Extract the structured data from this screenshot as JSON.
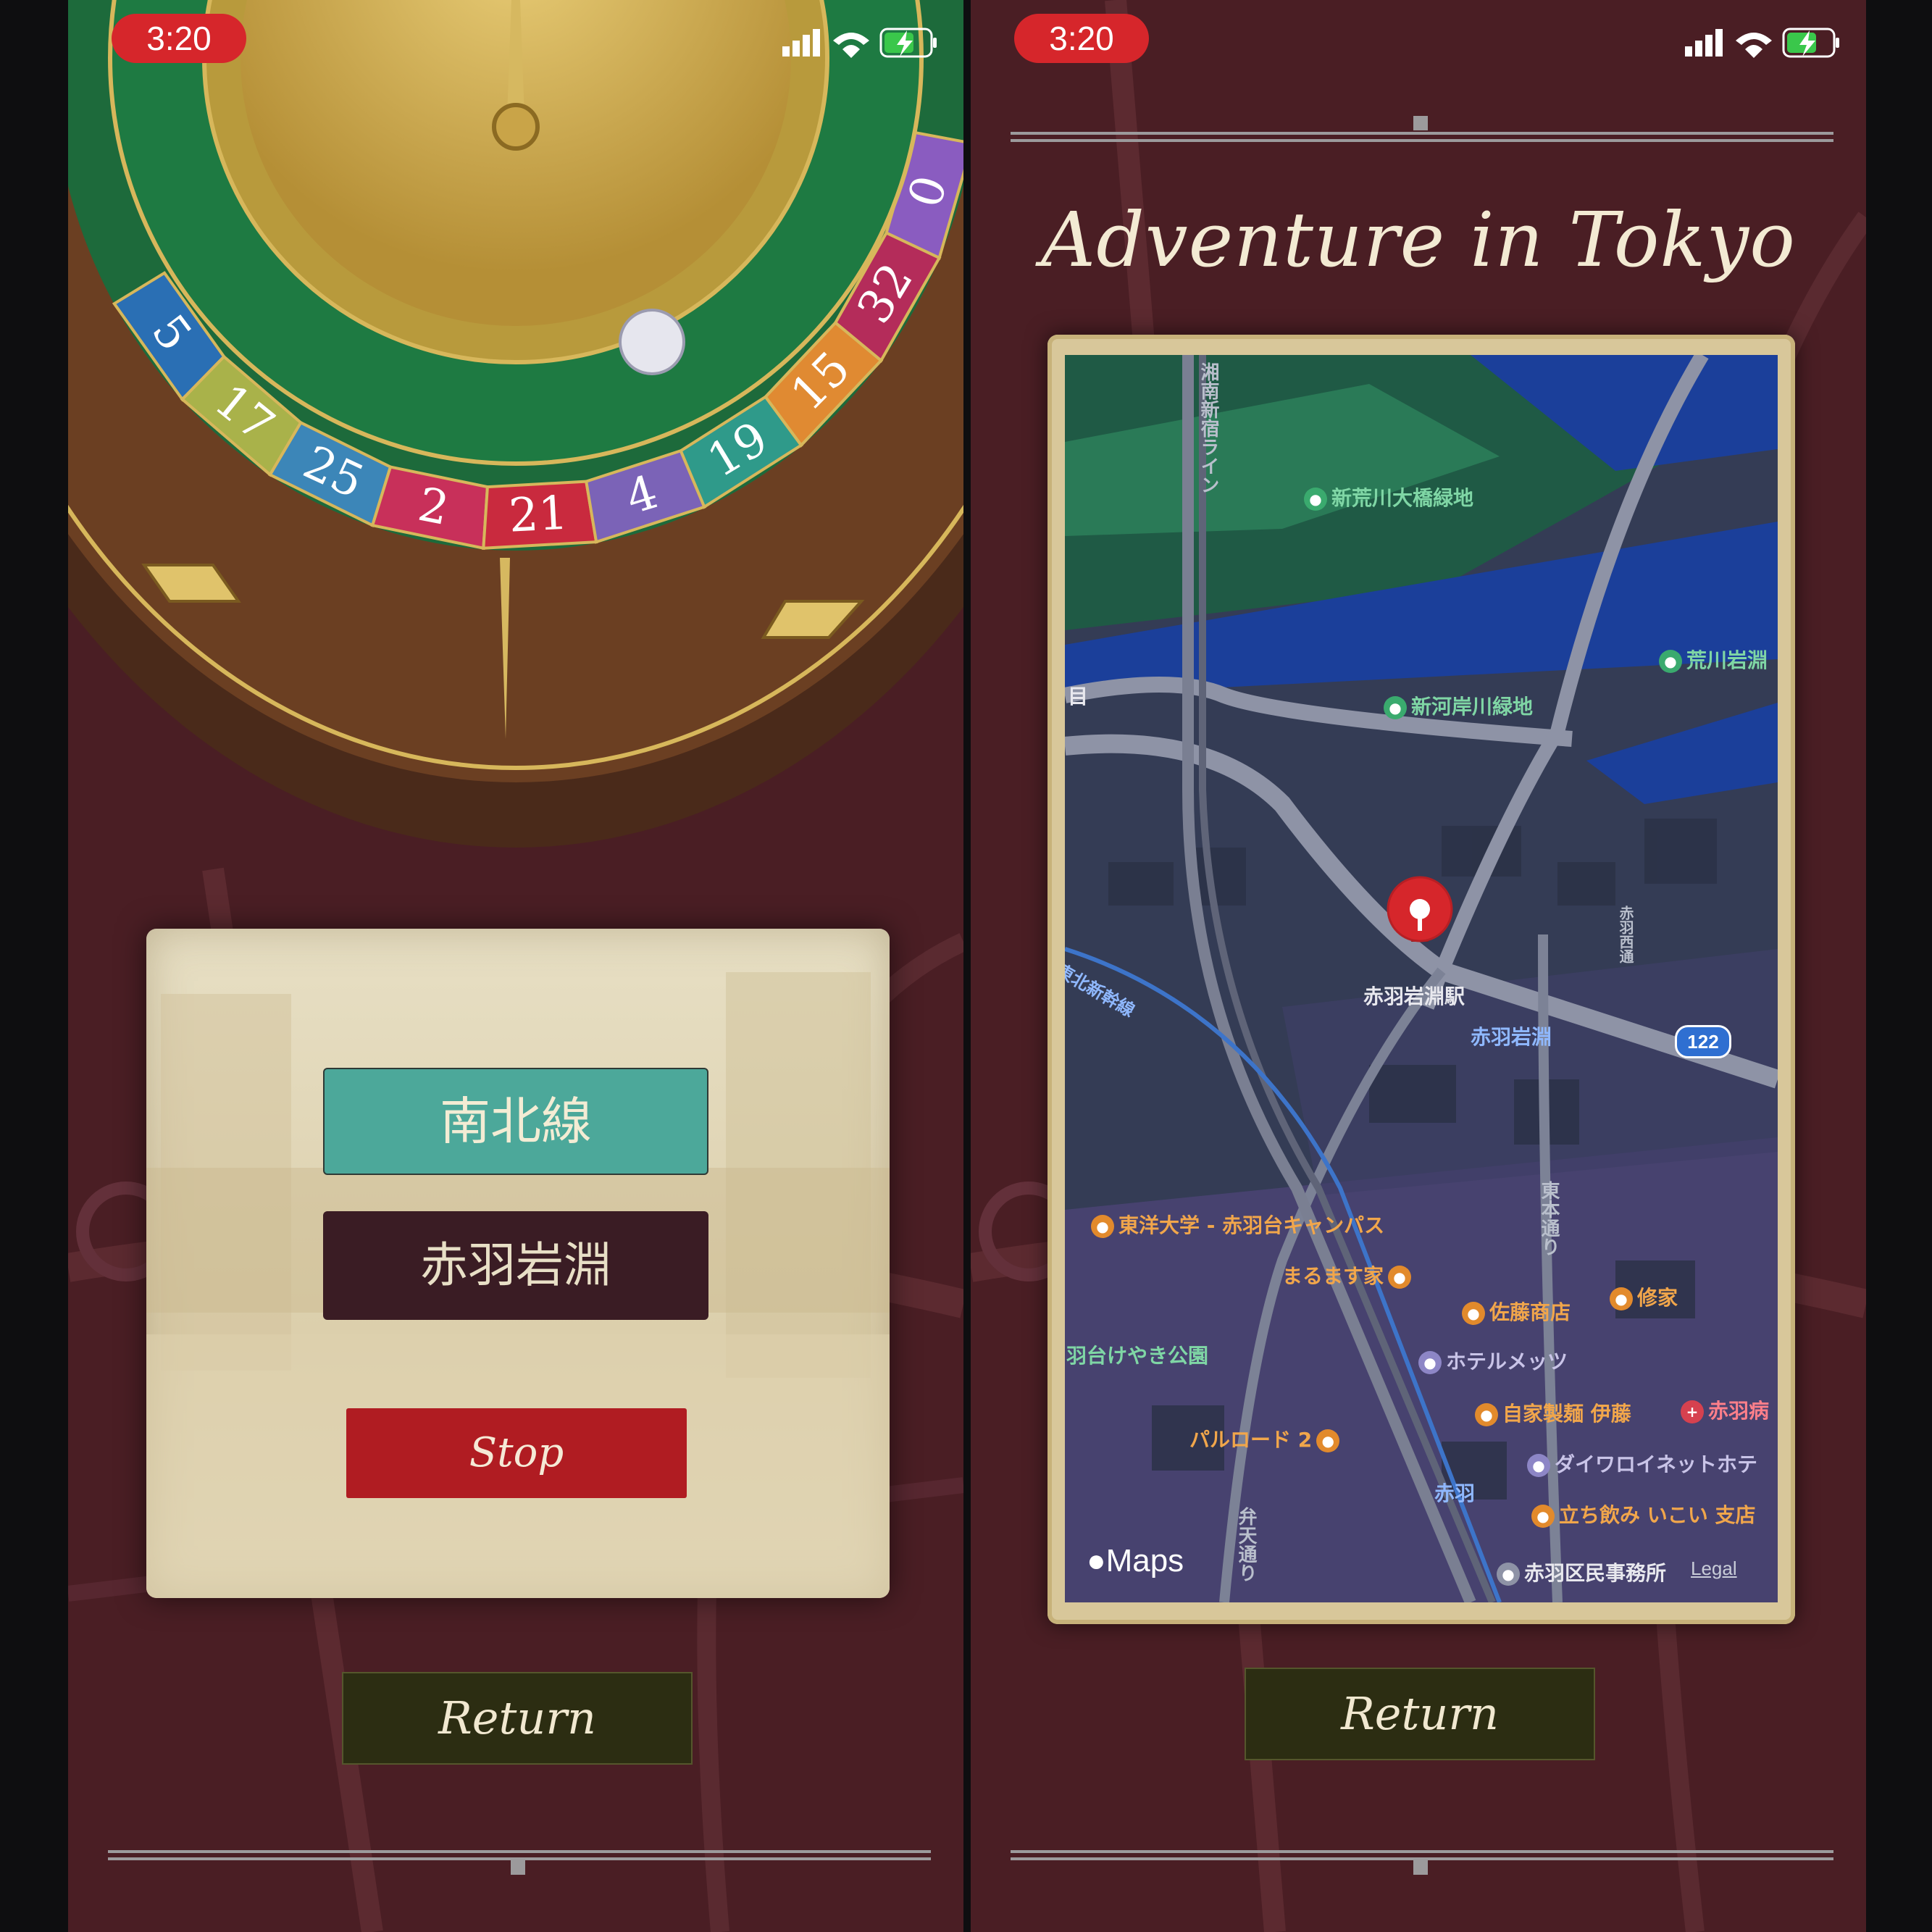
{
  "status_bar": {
    "time": "3:20"
  },
  "roulette": {
    "numbers": [
      "5",
      "17",
      "25",
      "2",
      "21",
      "4",
      "19",
      "15",
      "32",
      "0"
    ],
    "segment_colors": [
      "#2a6fb4",
      "#a9b24a",
      "#3c86b8",
      "#c8305a",
      "#c92a3e",
      "#7b63b7",
      "#2f9a8a",
      "#e08a32",
      "#b42c5a",
      "#8a5cc0"
    ]
  },
  "left_panel": {
    "line_label": "南北線",
    "station_label": "赤羽岩淵",
    "stop_label": "Stop"
  },
  "right_screen": {
    "title": "Adventure in Tokyo"
  },
  "map": {
    "labels": {
      "shinarakawa_park": "新荒川大橋緑地",
      "shinkagishi_park": "新河岸川緑地",
      "arakawa": "荒川岩淵",
      "akabaneiwabuchi_station": "赤羽岩淵駅",
      "akabaneiwabuchi": "赤羽岩淵",
      "toyo_univ": "東洋大学 - 赤羽台キャンパス",
      "marumasuya": "まるます家",
      "sato_shoten": "佐藤商店",
      "shuuka": "修家",
      "hotel_mets": "ホテルメッツ",
      "keyaki_park": "羽台けやき公園",
      "jika_seimen": "自家製麺 伊藤",
      "akabane_hosp": "赤羽病",
      "parlord": "パルロード 2",
      "daiwa_roynet": "ダイワロイネットホテ",
      "akabane": "赤羽",
      "tachinomi": "立ち飲み いこい 支店",
      "kuminjimusho": "赤羽区民事務所",
      "shonan_line": "湘南新宿ライン",
      "tohoku_shinkansen": "東北新幹線",
      "tohon_dori": "東本通り",
      "benten_dori": "弁天通り",
      "akabane_dori": "赤羽西通",
      "mark_me": "目"
    },
    "route_number": "122",
    "maps_label": "Maps",
    "legal_label": "Legal"
  },
  "buttons": {
    "return_label": "Return"
  },
  "colors": {
    "background": "#4a1e24",
    "line_button": "#4ca89a",
    "station_button": "#3a1c24",
    "stop_button": "#b01c22",
    "return_button": "#2c2d12"
  }
}
